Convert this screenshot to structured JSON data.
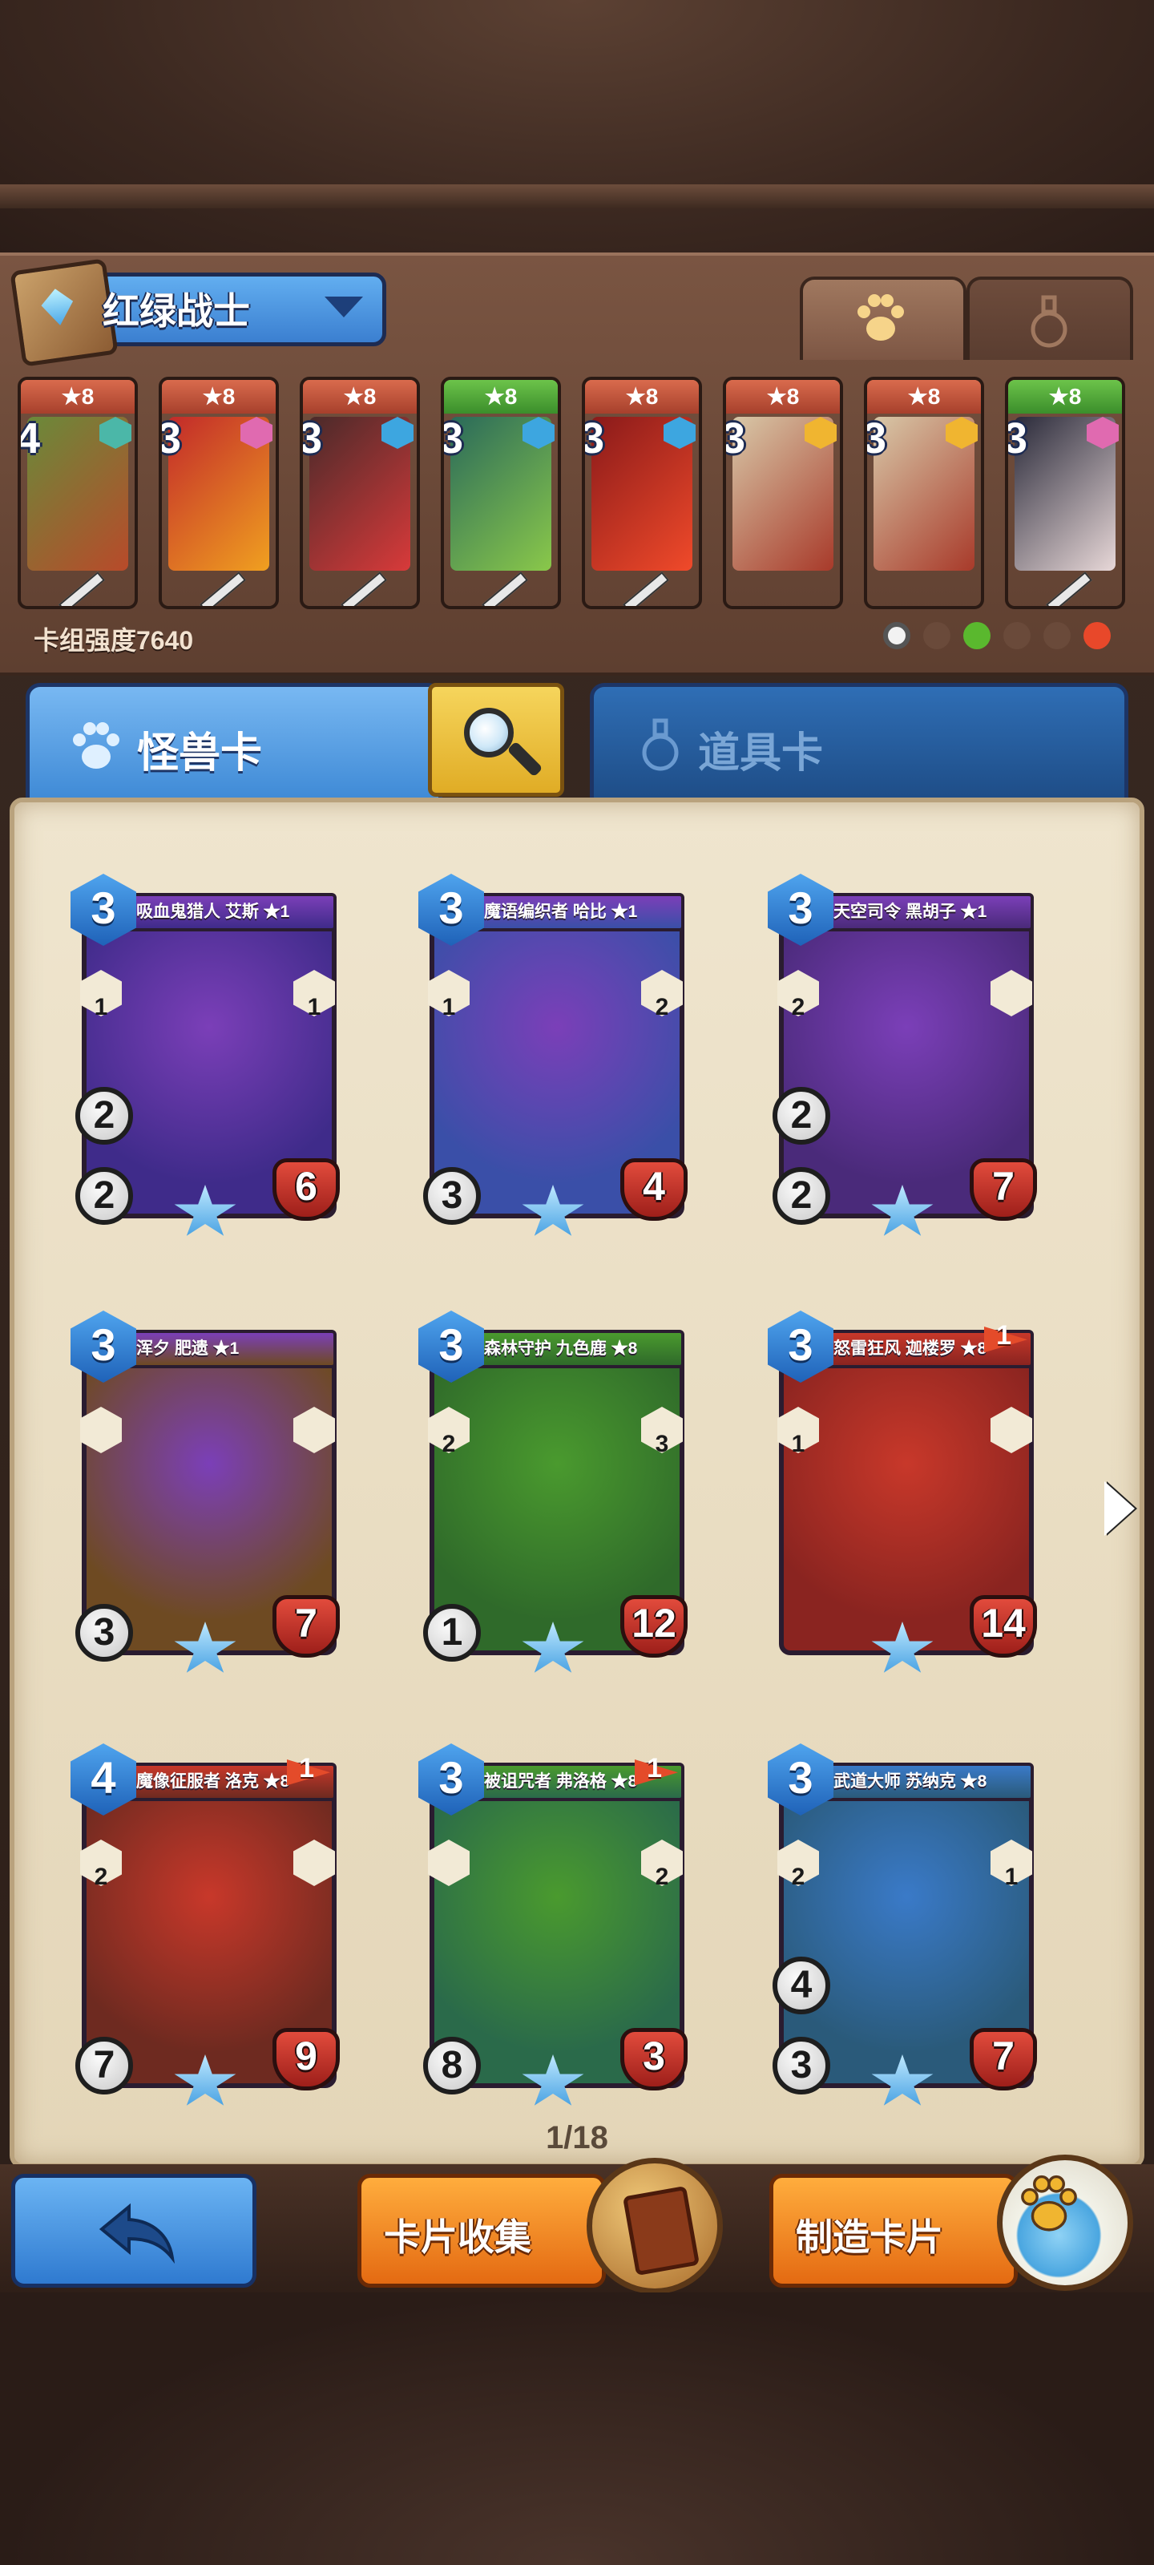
{
  "deck": {
    "name": "红绿战士",
    "strength_text": "卡组强度7640",
    "cards": [
      {
        "cost": "4",
        "stars": "★8",
        "color": "red",
        "elem": "#4bb7a8"
      },
      {
        "cost": "3",
        "stars": "★8",
        "color": "red",
        "elem": "#e06ab0"
      },
      {
        "cost": "3",
        "stars": "★8",
        "color": "red",
        "elem": "#3da6e0"
      },
      {
        "cost": "3",
        "stars": "★8",
        "color": "green",
        "elem": "#3da6e0"
      },
      {
        "cost": "3",
        "stars": "★8",
        "color": "red",
        "elem": "#3da6e0"
      },
      {
        "cost": "3",
        "stars": "★8",
        "color": "red",
        "elem": "#f0b530"
      },
      {
        "cost": "3",
        "stars": "★8",
        "color": "red",
        "elem": "#f0b530"
      },
      {
        "cost": "3",
        "stars": "★8",
        "color": "green",
        "elem": "#e06ab0"
      }
    ]
  },
  "tabs": {
    "monster": "怪兽卡",
    "item": "道具卡"
  },
  "cards": [
    {
      "name": "吸血鬼猎人 艾斯 ★1",
      "cost": "3",
      "atk": "2",
      "atk2": "2",
      "hp": "6",
      "skill_l": "1",
      "skill_r": "1",
      "banner": "#7b3fb8",
      "frame": "#3f2b8a",
      "flag": ""
    },
    {
      "name": "魔语编织者 哈比 ★1",
      "cost": "3",
      "atk": "",
      "atk2": "3",
      "hp": "4",
      "skill_l": "1",
      "skill_r": "2",
      "banner": "#7b3fb8",
      "frame": "#3a4fa8",
      "flag": ""
    },
    {
      "name": "天空司令 黑胡子 ★1",
      "cost": "3",
      "atk": "2",
      "atk2": "2",
      "hp": "7",
      "skill_l": "2",
      "skill_r": "",
      "banner": "#7b3fb8",
      "frame": "#4a2a7a",
      "flag": ""
    },
    {
      "name": "浑夕 肥遗 ★1",
      "cost": "3",
      "atk": "",
      "atk2": "3",
      "hp": "7",
      "skill_l": "",
      "skill_r": "",
      "banner": "#7b3fb8",
      "frame": "#6e4a22",
      "flag": ""
    },
    {
      "name": "森林守护 九色鹿 ★8",
      "cost": "3",
      "atk": "",
      "atk2": "1",
      "hp": "12",
      "skill_l": "2",
      "skill_r": "3",
      "banner": "#4a9a2e",
      "frame": "#2f6a2a",
      "flag": ""
    },
    {
      "name": "怒雷狂风 迦楼罗 ★8",
      "cost": "3",
      "atk": "",
      "atk2": "",
      "hp": "14",
      "skill_l": "1",
      "skill_r": "",
      "banner": "#c8382a",
      "frame": "#8a2420",
      "flag": "1"
    },
    {
      "name": "魔像征服者 洛克 ★8",
      "cost": "4",
      "atk": "",
      "atk2": "7",
      "hp": "9",
      "skill_l": "2",
      "skill_r": "",
      "banner": "#c8382a",
      "frame": "#6e2a20",
      "flag": "1"
    },
    {
      "name": "被诅咒者 弗洛格 ★8",
      "cost": "3",
      "atk": "",
      "atk2": "8",
      "hp": "3",
      "skill_l": "",
      "skill_r": "2",
      "banner": "#4a9a2e",
      "frame": "#2a6a4a",
      "flag": "1"
    },
    {
      "name": "武道大师 苏纳克 ★8",
      "cost": "3",
      "atk": "4",
      "atk2": "3",
      "hp": "7",
      "skill_l": "2",
      "skill_r": "1",
      "banner": "#3a7ac8",
      "frame": "#2a5a7a",
      "flag": ""
    }
  ],
  "page": "1/18",
  "buttons": {
    "collect": "卡片收集",
    "craft": "制造卡片"
  }
}
